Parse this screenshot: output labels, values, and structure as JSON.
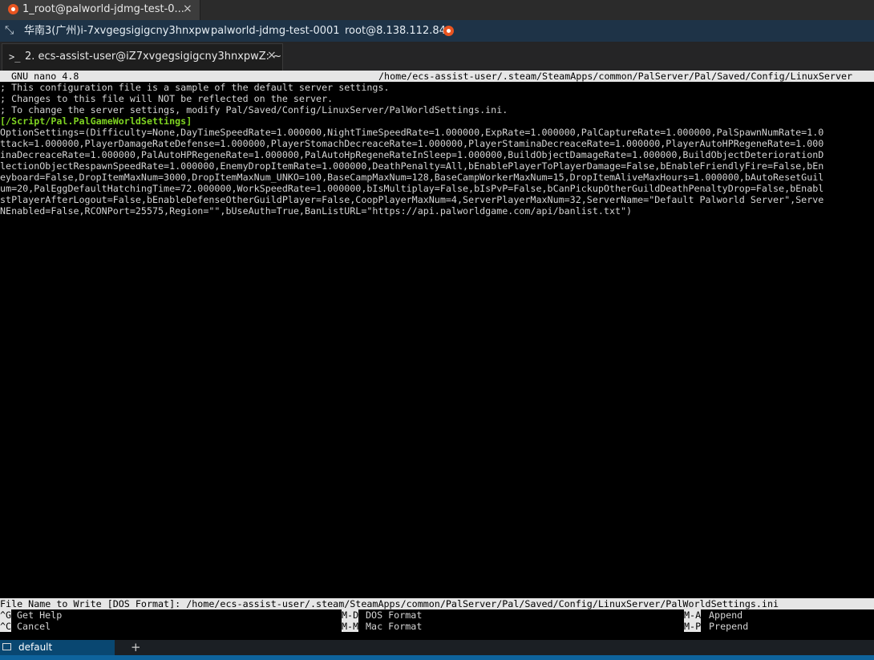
{
  "window": {
    "tab_title": "1_root@palworld-jdmg-test-0...",
    "tab_close": "×",
    "icon": "ubuntu-icon"
  },
  "infobar": {
    "region": "华南3(广州)i-7xvgegsigigcny3hnxpw",
    "instance": "palworld-jdmg-test-0001",
    "user": "root@8.138.112.84"
  },
  "session_tab": {
    "prompt": ">_",
    "title": "2. ecs-assist-user@iZ7xvgegsigigcny3hnxpwZ: ~",
    "close": "×"
  },
  "nano": {
    "version": "GNU nano 4.8",
    "path": "/home/ecs-assist-user/.steam/SteamApps/common/PalServer/Pal/Saved/Config/LinuxServer",
    "lines": [
      "; This configuration file is a sample of the default server settings.",
      "; Changes to this file will NOT be reflected on the server.",
      "; To change the server settings, modify Pal/Saved/Config/LinuxServer/PalWorldSettings.ini.",
      "[/Script/Pal.PalGameWorldSettings]",
      "OptionSettings=(Difficulty=None,DayTimeSpeedRate=1.000000,NightTimeSpeedRate=1.000000,ExpRate=1.000000,PalCaptureRate=1.000000,PalSpawnNumRate=1.0",
      "ttack=1.000000,PlayerDamageRateDefense=1.000000,PlayerStomachDecreaceRate=1.000000,PlayerStaminaDecreaceRate=1.000000,PlayerAutoHPRegeneRate=1.000",
      "inaDecreaceRate=1.000000,PalAutoHPRegeneRate=1.000000,PalAutoHpRegeneRateInSleep=1.000000,BuildObjectDamageRate=1.000000,BuildObjectDeteriorationD",
      "lectionObjectRespawnSpeedRate=1.000000,EnemyDropItemRate=1.000000,DeathPenalty=All,bEnablePlayerToPlayerDamage=False,bEnableFriendlyFire=False,bEn",
      "eyboard=False,DropItemMaxNum=3000,DropItemMaxNum_UNKO=100,BaseCampMaxNum=128,BaseCampWorkerMaxNum=15,DropItemAliveMaxHours=1.000000,bAutoResetGuil",
      "um=20,PalEggDefaultHatchingTime=72.000000,WorkSpeedRate=1.000000,bIsMultiplay=False,bIsPvP=False,bCanPickupOtherGuildDeathPenaltyDrop=False,bEnabl",
      "stPlayerAfterLogout=False,bEnableDefenseOtherGuildPlayer=False,CoopPlayerMaxNum=4,ServerPlayerMaxNum=32,ServerName=\"Default Palworld Server\",Serve",
      "NEnabled=False,RCONPort=25575,Region=\"\",bUseAuth=True,BanListURL=\"https://api.palworldgame.com/api/banlist.txt\")"
    ],
    "prompt_line": "File Name to Write [DOS Format]: /home/ecs-assist-user/.steam/SteamApps/common/PalServer/Pal/Saved/Config/LinuxServer/PalWorldSettings.ini",
    "shortcuts_row1": [
      {
        "key": "^G",
        "label": "Get Help"
      },
      {
        "key": "M-D",
        "label": "DOS Format"
      },
      {
        "key": "M-A",
        "label": "Append"
      }
    ],
    "shortcuts_row2": [
      {
        "key": "^C",
        "label": "Cancel"
      },
      {
        "key": "M-M",
        "label": "Mac Format"
      },
      {
        "key": "M-P",
        "label": "Prepend"
      }
    ]
  },
  "bottom": {
    "tab_label": "default",
    "add": "+"
  },
  "colors": {
    "section_header": "#7ed321",
    "infobar_bg": "#1e3347",
    "ubuntu": "#e95420"
  }
}
